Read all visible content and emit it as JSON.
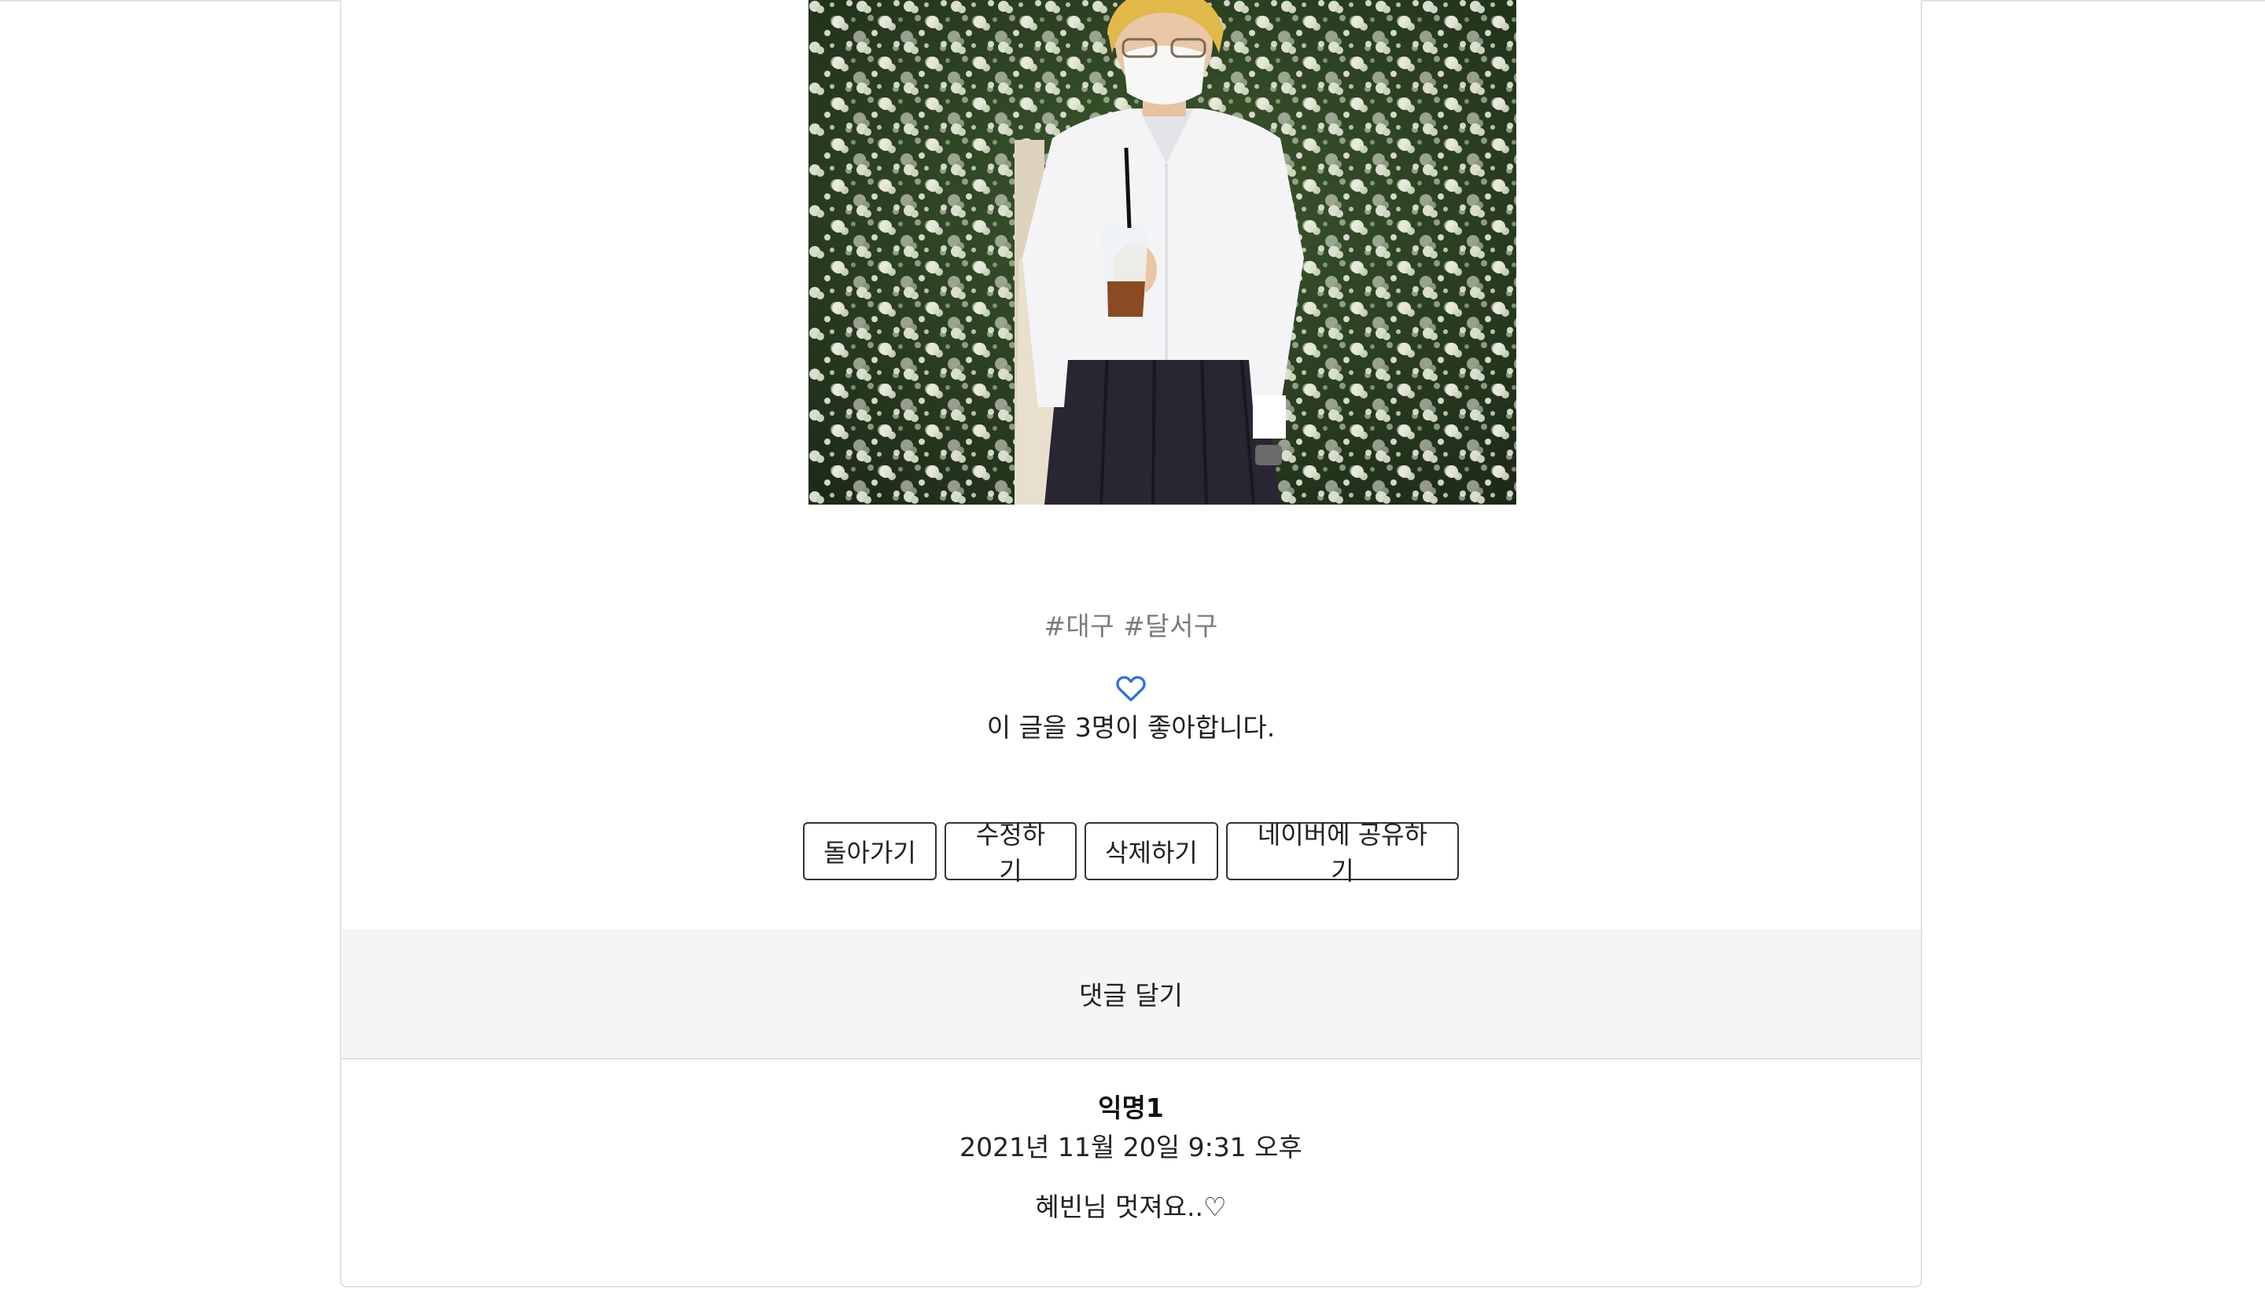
{
  "post": {
    "photo_alt": "",
    "hashtags": "#대구 #달서구",
    "likes_text": "이 글을 3명이 좋아합니다."
  },
  "actions": {
    "back_label": "돌아가기",
    "edit_label": "수정하기",
    "delete_label": "삭제하기",
    "share_label": "네이버에 공유하기"
  },
  "comments_section": {
    "write_label": "댓글 달기",
    "items": [
      {
        "author": "익명1",
        "date": "2021년 11월 20일 9:31 오후",
        "text": "혜빈님 멋져요..♡"
      }
    ]
  },
  "colors": {
    "accent_heart": "#2f6fe0",
    "comment_bar_bg": "#f5f5f5",
    "hashtag_text": "#7b7b7b"
  },
  "icons": {
    "like": "heart-outline-icon"
  }
}
